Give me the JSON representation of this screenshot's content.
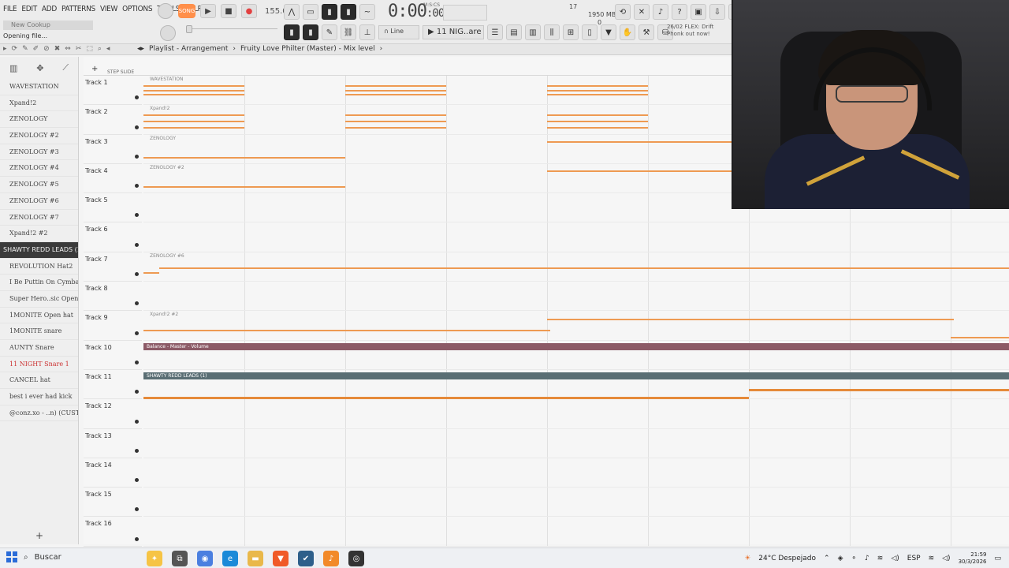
{
  "menu": [
    "FILE",
    "EDIT",
    "ADD",
    "PATTERNS",
    "VIEW",
    "OPTIONS",
    "TOOLS",
    "HELP"
  ],
  "file_hint": "New Cookup",
  "status": "Opening file...",
  "transport": {
    "mode": "SONG",
    "tempo": "155.000",
    "time": "0:00",
    "time_small": ":00",
    "time_label": "M:S:CS"
  },
  "meter": {
    "cpu": "17",
    "memory": "1950 MB",
    "polyphony": "0"
  },
  "snap": "Line",
  "pattern": "11 NIG..are 1",
  "news": "26/02 FLEX: Drift Phonk out now!",
  "breadcrumb": [
    "Playlist - Arrangement",
    "Fruity Love Philter (Master) - Mix level"
  ],
  "browser": {
    "items": [
      {
        "label": "WAVESTATION",
        "selected": false,
        "red": false
      },
      {
        "label": "Xpand!2",
        "selected": false,
        "red": false
      },
      {
        "label": "ZENOLOGY",
        "selected": false,
        "red": false
      },
      {
        "label": "ZENOLOGY #2",
        "selected": false,
        "red": false
      },
      {
        "label": "ZENOLOGY #3",
        "selected": false,
        "red": false
      },
      {
        "label": "ZENOLOGY #4",
        "selected": false,
        "red": false
      },
      {
        "label": "ZENOLOGY #5",
        "selected": false,
        "red": false
      },
      {
        "label": "ZENOLOGY #6",
        "selected": false,
        "red": false
      },
      {
        "label": "ZENOLOGY #7",
        "selected": false,
        "red": false
      },
      {
        "label": "Xpand!2 #2",
        "selected": false,
        "red": false
      },
      {
        "label": "SHAWTY REDD LEADS (1)",
        "selected": true,
        "red": false
      },
      {
        "label": "REVOLUTION Hat2",
        "selected": false,
        "red": false
      },
      {
        "label": "I Be Puttin On Cymbal",
        "selected": false,
        "red": false
      },
      {
        "label": "Super Hero..sic Openhat",
        "selected": false,
        "red": false
      },
      {
        "label": "1MONITE Open hat",
        "selected": false,
        "red": false
      },
      {
        "label": "1MONITE snare",
        "selected": false,
        "red": false
      },
      {
        "label": "AUNTY Snare",
        "selected": false,
        "red": false
      },
      {
        "label": "11 NIGHT Snare 1",
        "selected": false,
        "red": true
      },
      {
        "label": "CANCEL hat",
        "selected": false,
        "red": false
      },
      {
        "label": "best i ever had kick",
        "selected": false,
        "red": false
      },
      {
        "label": "@conz.xo - ..n) (CUSTOM)",
        "selected": false,
        "red": false
      }
    ]
  },
  "playlist": {
    "toolbar_labels": "STEP  SLIDE",
    "tracks": [
      "Track 1",
      "Track 2",
      "Track 3",
      "Track 4",
      "Track 5",
      "Track 6",
      "Track 7",
      "Track 8",
      "Track 9",
      "Track 10",
      "Track 11",
      "Track 12",
      "Track 13",
      "Track 14",
      "Track 15",
      "Track 16"
    ],
    "clip_labels": {
      "t1": "WAVESTATION",
      "t2": "Xpand!2",
      "t3": "ZENOLOGY",
      "t4": "ZENOLOGY #2",
      "t7": "ZENOLOGY #6",
      "t9": "Xpand!2 #2",
      "t10": "Balance - Master - Volume",
      "t11": "SHAWTY REDD LEADS (1)"
    }
  },
  "taskbar": {
    "search": "Buscar",
    "weather": "24°C  Despejado",
    "lang": "ESP",
    "time": "21:59",
    "date": "30/3/2026"
  }
}
